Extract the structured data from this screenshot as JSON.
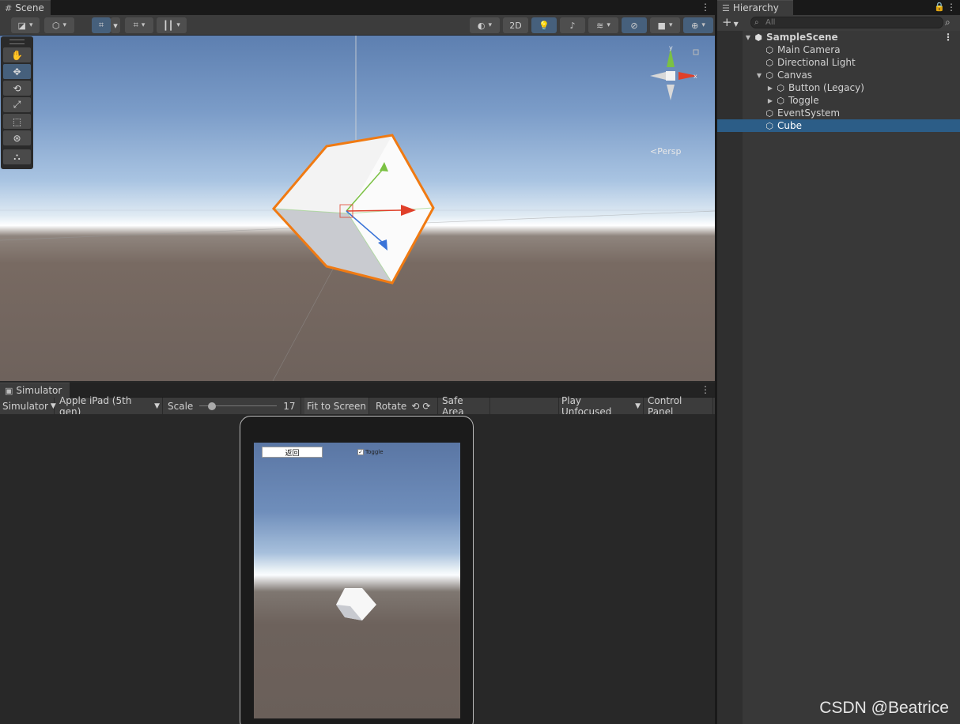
{
  "scene": {
    "tab": "Scene",
    "toolbar": {
      "mode_2d": "2D"
    },
    "persp_label": "<Persp",
    "gizmo": {
      "x": "x",
      "y": "y"
    }
  },
  "simulator": {
    "tab": "Simulator",
    "toolbar": {
      "view": "Simulator",
      "device": "Apple iPad (5th gen)",
      "scale_label": "Scale",
      "scale_value": "17",
      "fit": "Fit to Screen",
      "rotate": "Rotate",
      "safe_area": "Safe Area",
      "play_mode": "Play Unfocused",
      "control_panel": "Control Panel"
    },
    "scale_slider_fraction": 0.12,
    "screen": {
      "button_label": "返回",
      "toggle_label": "Toggle",
      "toggle_checked": "✓"
    }
  },
  "hierarchy": {
    "tab": "Hierarchy",
    "add_label": "+",
    "search_placeholder": "All",
    "items": [
      {
        "label": "SampleScene",
        "expanded": true
      },
      {
        "label": "Main Camera"
      },
      {
        "label": "Directional Light"
      },
      {
        "label": "Canvas",
        "expanded": true
      },
      {
        "label": "Button (Legacy)",
        "collapsed": true
      },
      {
        "label": "Toggle",
        "collapsed": true
      },
      {
        "label": "EventSystem"
      },
      {
        "label": "Cube",
        "selected": true
      }
    ]
  },
  "watermark": "CSDN @Beatrice",
  "colors": {
    "selection": "#2c5d87",
    "accent_button": "#46607c",
    "cube_outline": "#f07a12",
    "gizmo_x": "#e0402a",
    "gizmo_y": "#7bc143",
    "gizmo_z": "#3a74d8"
  }
}
